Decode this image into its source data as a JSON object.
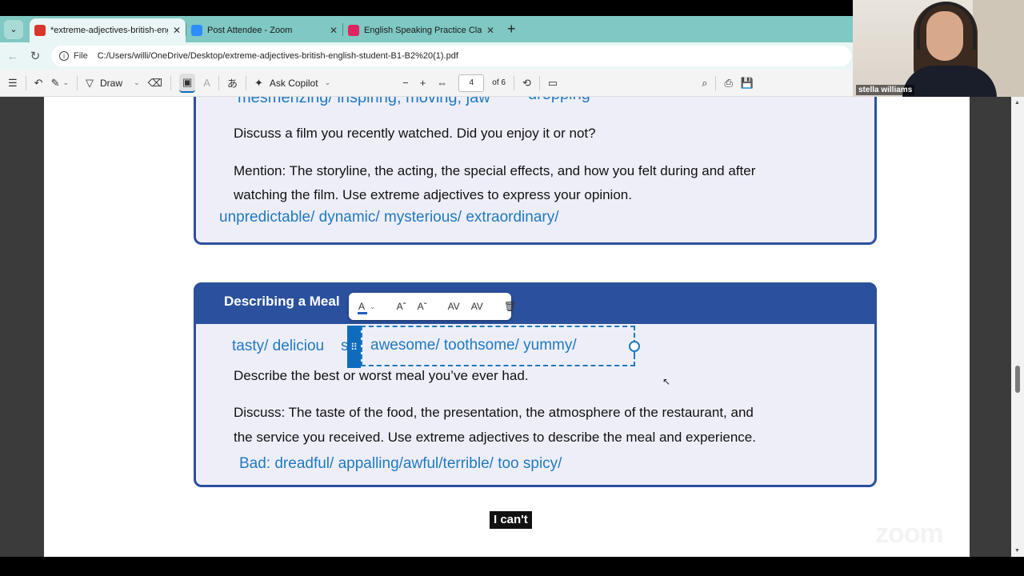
{
  "browser": {
    "tabs": [
      {
        "label": "*extreme-adjectives-british-englis",
        "favicon_color": "#d9362b",
        "active": true
      },
      {
        "label": "Post Attendee - Zoom",
        "favicon_color": "#2d8cff",
        "active": false
      },
      {
        "label": "English Speaking Practice Class | T",
        "favicon_color": "#e0245e",
        "active": false
      }
    ],
    "address": {
      "protocol": "File",
      "url": "C:/Users/willi/OneDrive/Desktop/extreme-adjectives-british-english-student-B1-B2%20(1).pdf"
    }
  },
  "pdf_toolbar": {
    "draw_label": "Draw",
    "copilot_label": "Ask Copilot",
    "page_number": "4",
    "page_total": "of 6"
  },
  "webcam": {
    "participant_name": "stella williams"
  },
  "document": {
    "card1": {
      "top_words": "mesmerizing/ inspiring, moving, jaw",
      "top_words_overflow": "dropping",
      "prompt": "Discuss a film you recently watched. Did you enjoy it or not?",
      "mention_line1": "Mention: The storyline, the acting, the special effects, and how you felt during and after",
      "mention_line2": "watching the film. Use extreme adjectives to express your opinion.",
      "adjectives": "unpredictable/ dynamic/ mysterious/ extraordinary/"
    },
    "card2": {
      "title": "Describing a Meal",
      "adjectives_left": "tasty/ deliciou",
      "adjectives_left_cut": "s",
      "adjectives_selected": "awesome/ toothsome/ yummy/",
      "prompt": "Describe the best or worst meal you’ve ever had.",
      "discuss_line1": "Discuss: The taste of the food, the presentation, the atmosphere of the restaurant, and",
      "discuss_line2": "the service you received. Use extreme adjectives to describe the meal and experience.",
      "bad": "Bad:  dreadful/ appalling/awful/terrible/ too spicy/"
    }
  },
  "caption": "I can't",
  "watermark": "zoom",
  "colors": {
    "accent_blue": "#1f7ac0",
    "card_header": "#2b519e",
    "tab_bar": "#7fc8c3"
  }
}
